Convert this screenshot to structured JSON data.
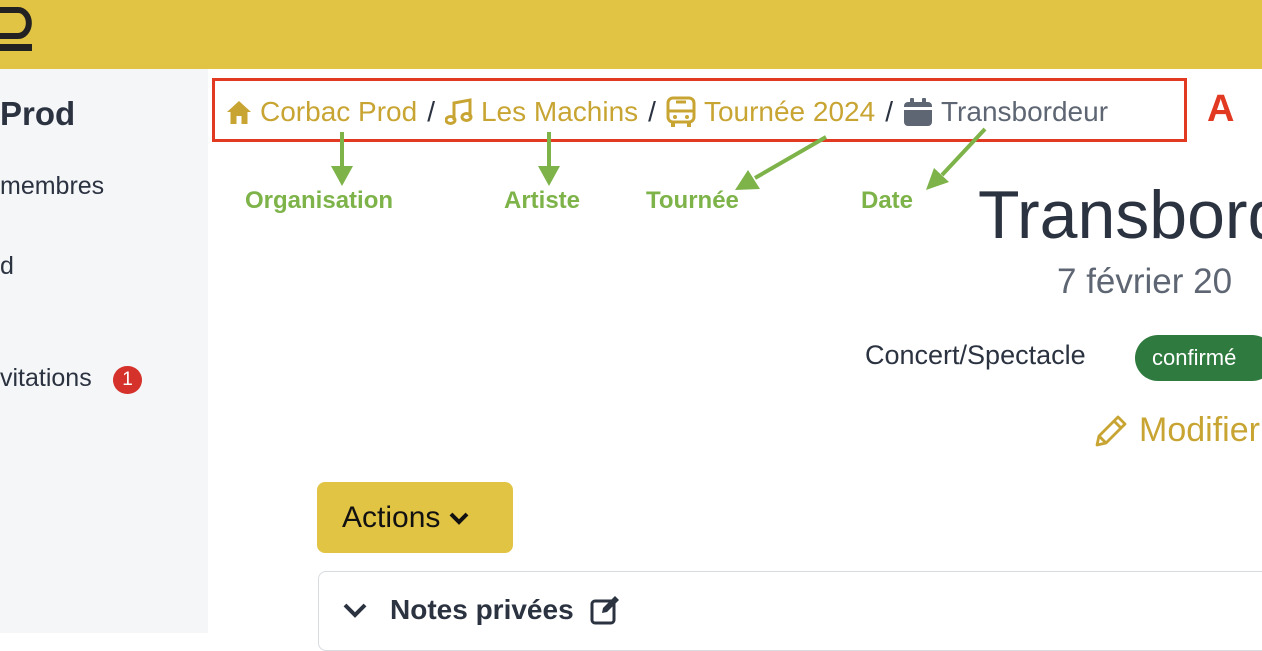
{
  "sidebar": {
    "org_name_fragment": "Prod",
    "items": [
      {
        "label": "membres"
      },
      {
        "label": "d"
      },
      {
        "label": "vitations",
        "badge": "1"
      }
    ]
  },
  "breadcrumb": {
    "items": [
      {
        "label": "Corbac Prod",
        "icon": "home-icon"
      },
      {
        "label": "Les Machins",
        "icon": "music-note-icon"
      },
      {
        "label": "Tournée 2024",
        "icon": "bus-icon"
      },
      {
        "label": "Transbordeur",
        "icon": "calendar-icon"
      }
    ],
    "separator": "/"
  },
  "annotations": {
    "callout_letter": "A",
    "labels": [
      "Organisation",
      "Artiste",
      "Tournée",
      "Date"
    ]
  },
  "event": {
    "title": "Transbord",
    "date": "7 février 20",
    "type": "Concert/Spectacle",
    "status": "confirmé",
    "edit_label": "Modifier"
  },
  "actions": {
    "label": "Actions"
  },
  "notes_panel": {
    "title": "Notes privées"
  },
  "colors": {
    "brand_yellow": "#e2c444",
    "link_gold": "#c8a533",
    "status_green": "#2f7a3f",
    "callout_red": "#e23a22",
    "annotation_green": "#7db349",
    "badge_red": "#d5322c"
  }
}
